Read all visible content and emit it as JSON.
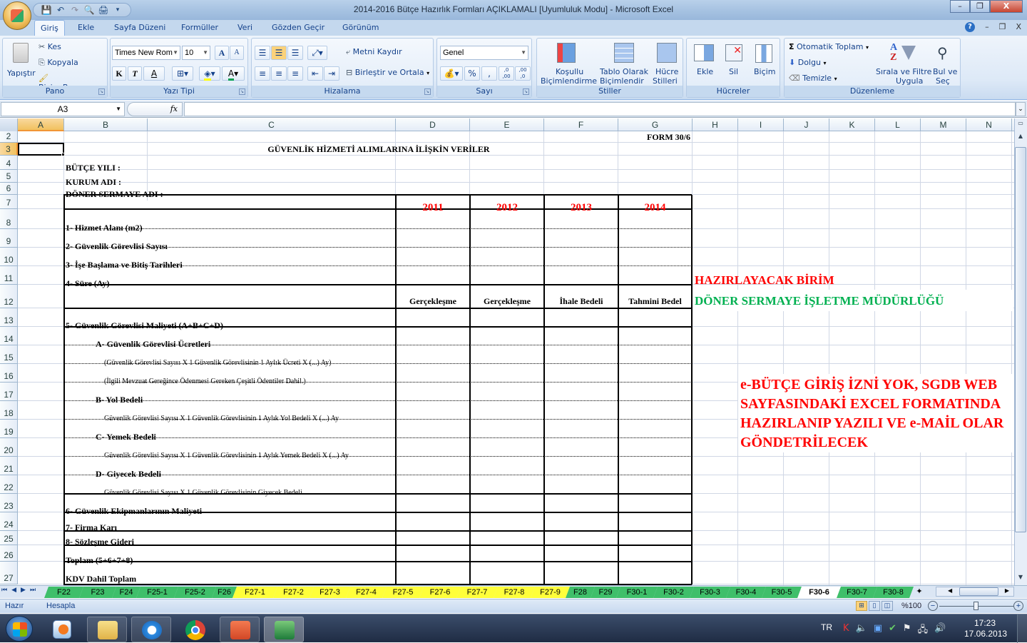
{
  "window": {
    "title": "2014-2016 Bütçe Hazırlık Formları AÇIKLAMALI  [Uyumluluk Modu] - Microsoft Excel",
    "controls": {
      "minimize": "–",
      "restore": "❐",
      "close": "X"
    }
  },
  "quick_access": {
    "icons": [
      "save-icon",
      "undo-icon",
      "redo-icon",
      "print-preview-icon",
      "quick-print-icon",
      "customize-icon"
    ]
  },
  "ribbon_tabs": [
    {
      "label": "Giriş",
      "active": true
    },
    {
      "label": "Ekle"
    },
    {
      "label": "Sayfa Düzeni"
    },
    {
      "label": "Formüller"
    },
    {
      "label": "Veri"
    },
    {
      "label": "Gözden Geçir"
    },
    {
      "label": "Görünüm"
    }
  ],
  "mdi_controls": {
    "help": "?",
    "minimize": "–",
    "restore": "❐",
    "close": "X"
  },
  "ribbon": {
    "pano": {
      "label": "Pano",
      "paste": "Yapıştır",
      "cut": "Kes",
      "copy": "Kopyala",
      "format_painter": "Biçim Boyacısı"
    },
    "yazi_tipi": {
      "label": "Yazı Tipi",
      "font": "Times New Rom",
      "size": "10",
      "bold": "K",
      "italic": "T",
      "underline": "A",
      "grow": "A",
      "shrink": "A",
      "font_color": "A"
    },
    "hizalama": {
      "label": "Hizalama",
      "wrap": "Metni Kaydır",
      "merge": "Birleştir ve Ortala"
    },
    "sayi": {
      "label": "Sayı",
      "format": "Genel",
      "percent": "%",
      "comma": ",",
      "inc_decimal": ",0 ,00",
      "dec_decimal": ",00 ,0"
    },
    "stiller": {
      "label": "Stiller",
      "conditional": [
        "Koşullu",
        "Biçimlendirme"
      ],
      "table": [
        "Tablo Olarak",
        "Biçimlendir"
      ],
      "cell_styles": [
        "Hücre",
        "Stilleri"
      ]
    },
    "hucreler": {
      "label": "Hücreler",
      "insert": "Ekle",
      "delete": "Sil",
      "format": "Biçim"
    },
    "duzenleme": {
      "label": "Düzenleme",
      "autosum": "Otomatik Toplam",
      "fill": "Dolgu",
      "clear": "Temizle",
      "sort": [
        "Sırala ve Filtre",
        "Uygula"
      ],
      "find": [
        "Bul ve",
        "Seç"
      ]
    }
  },
  "formula_bar": {
    "name_box": "A3",
    "fx": "fx",
    "value": ""
  },
  "columns": [
    "A",
    "B",
    "C",
    "D",
    "E",
    "F",
    "G",
    "H",
    "I",
    "J",
    "K",
    "L",
    "M",
    "N"
  ],
  "selected_column": "A",
  "rows": [
    "2",
    "3",
    "4",
    "5",
    "6",
    "7",
    "8",
    "9",
    "10",
    "11",
    "12",
    "13",
    "14",
    "15",
    "16",
    "17",
    "18",
    "19",
    "20",
    "21",
    "22",
    "23",
    "24",
    "25",
    "26",
    "27"
  ],
  "selected_row": "3",
  "sheet": {
    "form_no": "FORM 30/6",
    "title": "GÜVENLİK HİZMETİ ALIMLARINA İLİŞKİN VERİLER",
    "butce_yili": "BÜTÇE YILI :",
    "kurum_adi": "KURUM ADI :",
    "doner_sermaye_adi": "DÖNER SERMAYE ADI :",
    "years": [
      "2011",
      "2012",
      "2013",
      "2014"
    ],
    "year_types": [
      "Gerçekleşme",
      "Gerçekleşme",
      "İhale Bedeli",
      "Tahmini Bedel"
    ],
    "items": {
      "r8": "1-  Hizmet Alanı (m2)",
      "r9": "2-  Güvenlik Görevlisi Sayısı",
      "r10": "3-  İşe Başlama ve Bitiş Tarihleri",
      "r11": "4- Süre (Ay)",
      "r13": "5-  Güvenlik Görevlisi Maliyeti (A+B+C+D)",
      "r14": "A- Güvenlik Görevlisi Ücretleri",
      "r15": "(Güvenlik Görevlisi Sayısı X 1 Güvenlik Görevlisinin 1 Aylık Ücreti X (...) Ay)",
      "r16": "(İlgili Mevzuat Gereğince Ödenmesi Gereken Çeşitli Ödentiler Dahil.)",
      "r17": "B- Yol Bedeli",
      "r18": "Güvenlik Görevlisi Sayısı X 1 Güvenlik Görevlisinin 1 Aylık Yol Bedeli X  (...) Ay",
      "r19": "C- Yemek Bedeli",
      "r20": "Güvenlik Görevlisi Sayısı X 1  Güvenlik Görevlisinin 1 Aylık Yemek  Bedeli X  (...) Ay",
      "r21": "D- Giyecek Bedeli",
      "r22": "Güvenlik Görevlisi Sayısı X 1  Güvenlik Görevlisinin Giyecek  Bedeli",
      "r23": "6- Güvenlik Ekipmanlarının Maliyeti",
      "r24": "7- Firma Karı",
      "r25": "8- Sözleşme Gideri",
      "r26": "Toplam (5+6+7+8)",
      "r27": "KDV Dahil Toplam"
    },
    "note_unit_label": "HAZIRLAYACAK BİRİM",
    "note_unit_value": "DÖNER SERMAYE İŞLETME MÜDÜRLÜĞÜ",
    "note_lines": [
      "e-BÜTÇE GİRİŞ İZNİ YOK, SGDB WEB",
      "SAYFASINDAKİ EXCEL FORMATINDA",
      "HAZIRLANIP YAZILI VE e-MAİL OLAR",
      "GÖNDETRİLECEK"
    ],
    "colors": {
      "year": "#ff0000",
      "unit_label": "#ff0000",
      "unit_value": "#00b050",
      "note": "#ff0000"
    }
  },
  "sheet_tabs": [
    {
      "label": "F22",
      "color": "#3fbf6a"
    },
    {
      "label": "F23",
      "color": "#3fbf6a"
    },
    {
      "label": "F24",
      "color": "#3fbf6a"
    },
    {
      "label": "F25-1",
      "color": "#3fbf6a"
    },
    {
      "label": "F25-2",
      "color": "#3fbf6a"
    },
    {
      "label": "F26",
      "color": "#3fbf6a"
    },
    {
      "label": "F27-1",
      "color": "#ffff3a"
    },
    {
      "label": "F27-2",
      "color": "#ffff3a"
    },
    {
      "label": "F27-3",
      "color": "#ffff3a"
    },
    {
      "label": "F27-4",
      "color": "#ffff3a"
    },
    {
      "label": "F27-5",
      "color": "#ffff3a"
    },
    {
      "label": "F27-6",
      "color": "#ffff3a"
    },
    {
      "label": "F27-7",
      "color": "#ffff3a"
    },
    {
      "label": "F27-8",
      "color": "#ffff3a"
    },
    {
      "label": "F27-9",
      "color": "#ffff3a"
    },
    {
      "label": "F28",
      "color": "#3fbf6a"
    },
    {
      "label": "F29",
      "color": "#3fbf6a"
    },
    {
      "label": "F30-1",
      "color": "#3fbf6a"
    },
    {
      "label": "F30-2",
      "color": "#3fbf6a"
    },
    {
      "label": "F30-3",
      "color": "#3fbf6a"
    },
    {
      "label": "F30-4",
      "color": "#3fbf6a"
    },
    {
      "label": "F30-5",
      "color": "#3fbf6a"
    },
    {
      "label": "F30-6",
      "color": "#ffffff",
      "active": true
    },
    {
      "label": "F30-7",
      "color": "#3fbf6a"
    },
    {
      "label": "F30-8",
      "color": "#3fbf6a"
    }
  ],
  "status_bar": {
    "ready": "Hazır",
    "calculate": "Hesapla",
    "zoom": "%100"
  },
  "taskbar": {
    "apps": [
      "windows-media-player",
      "windows-explorer",
      "internet-explorer",
      "google-chrome",
      "powerpoint",
      "excel"
    ],
    "language": "TR",
    "time": "17:23",
    "date": "17.06.2013"
  }
}
